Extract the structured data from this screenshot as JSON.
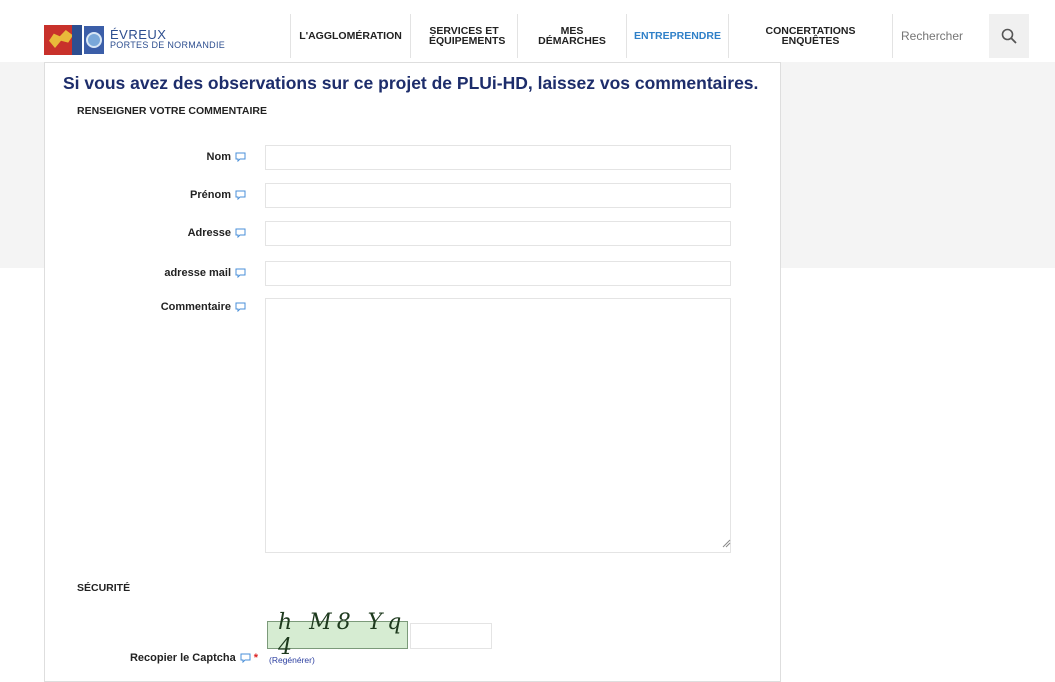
{
  "header": {
    "brand_line1": "ÉVREUX",
    "brand_line2": "PORTES DE NORMANDIE",
    "nav": [
      {
        "label": "L'AGGLOMÉRATION"
      },
      {
        "label": "SERVICES ET ÉQUIPEMENTS"
      },
      {
        "label": "MES DÉMARCHES"
      },
      {
        "label": "ENTREPRENDRE"
      },
      {
        "label": "CONCERTATIONS ENQUÊTES"
      }
    ],
    "search_placeholder": "Rechercher"
  },
  "form": {
    "title": "Si vous avez des observations sur ce projet de PLUi-HD, laissez vos commentaires.",
    "section_comment": "RENSEIGNER VOTRE COMMENTAIRE",
    "fields": [
      {
        "label": "Nom",
        "value": ""
      },
      {
        "label": "Prénom",
        "value": ""
      },
      {
        "label": "Adresse",
        "value": ""
      },
      {
        "label": "adresse mail",
        "value": ""
      },
      {
        "label": "Commentaire",
        "value": ""
      }
    ],
    "section_security": "SÉCURITÉ",
    "captcha_label": "Recopier le Captcha",
    "captcha_required": "*",
    "captcha_text": "h M8 Yq 4",
    "captcha_value": "",
    "regenerate": "(Regénérer)"
  },
  "colors": {
    "title": "#1d2d6b",
    "active_nav": "#2f80c8",
    "bubble_icon": "#4a8fd8",
    "link": "#2c3fa0",
    "required": "#dd2222"
  }
}
